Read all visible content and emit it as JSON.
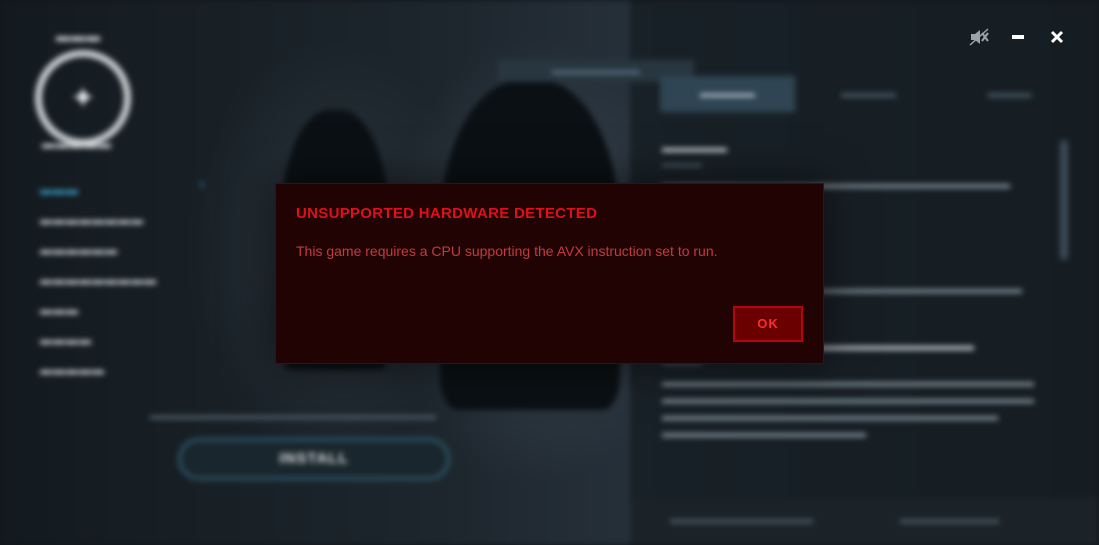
{
  "window_controls": {
    "mute_icon": "speaker-muted-icon",
    "minimize_icon": "minimize-icon",
    "close_icon": "close-icon",
    "icon_color": "#ffffff"
  },
  "dialog": {
    "title": "UNSUPPORTED HARDWARE DETECTED",
    "message": "This game requires a CPU supporting the AVX instruction set to run.",
    "ok_label": "OK",
    "accent_color": "#e0101a",
    "background_color": "#220304"
  },
  "install": {
    "button_label": "INSTALL"
  }
}
